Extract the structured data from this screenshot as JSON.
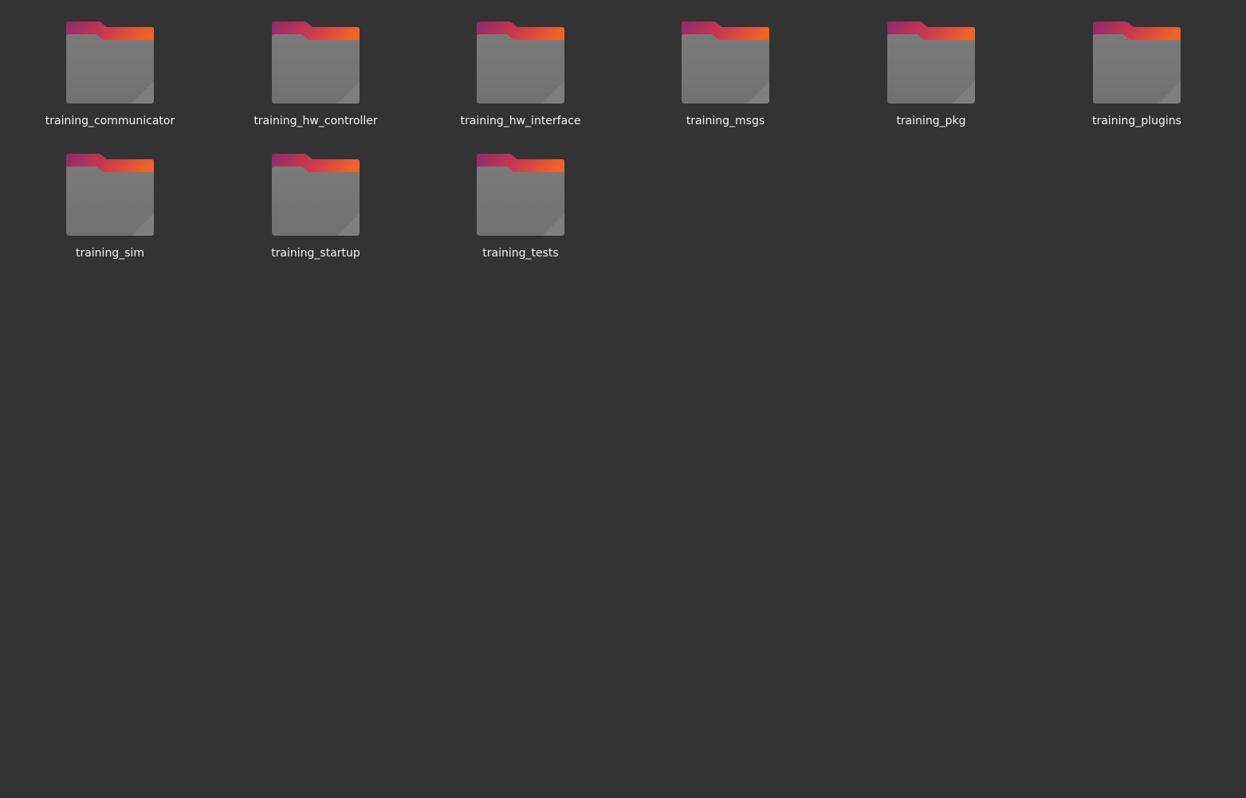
{
  "theme": {
    "background": "#333333",
    "label_color": "#f2f2f2",
    "folder_tab_gradient": [
      "#8f2a6a",
      "#c8384e",
      "#f2622b"
    ],
    "folder_body": "#767676"
  },
  "folders": [
    {
      "name": "training_communicator",
      "icon": "folder-icon"
    },
    {
      "name": "training_hw_controller",
      "icon": "folder-icon"
    },
    {
      "name": "training_hw_interface",
      "icon": "folder-icon"
    },
    {
      "name": "training_msgs",
      "icon": "folder-icon"
    },
    {
      "name": "training_pkg",
      "icon": "folder-icon"
    },
    {
      "name": "training_plugins",
      "icon": "folder-icon"
    },
    {
      "name": "training_sim",
      "icon": "folder-icon"
    },
    {
      "name": "training_startup",
      "icon": "folder-icon"
    },
    {
      "name": "training_tests",
      "icon": "folder-icon"
    }
  ]
}
